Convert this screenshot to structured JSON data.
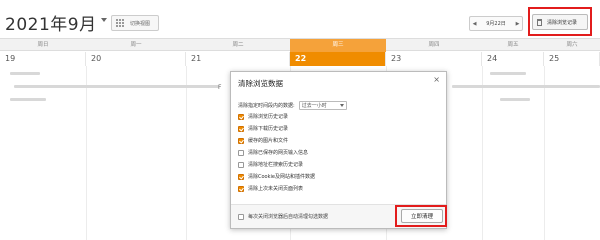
{
  "header": {
    "month_title": "2021年9月",
    "toggle_view_label": "切换视图",
    "date_nav_value": "9月22日",
    "clear_history_label": "清除浏览记录"
  },
  "calendar": {
    "weekdays": [
      "周日",
      "周一",
      "周二",
      "周三",
      "周四",
      "周五",
      "周六"
    ],
    "days": [
      "19",
      "20",
      "21",
      "22",
      "23",
      "24",
      "25"
    ],
    "today_index": 3,
    "event_fragment": "F",
    "accent_color": "#f08c00"
  },
  "dialog": {
    "title": "清除浏览数据",
    "range_label": "清除指定时间段内的数据:",
    "range_value": "过去一小时",
    "options": [
      {
        "label": "清除浏览历史记录",
        "checked": true
      },
      {
        "label": "清除下载历史记录",
        "checked": true
      },
      {
        "label": "缓存的图片和文件",
        "checked": true
      },
      {
        "label": "清除已保存的网页输入信息",
        "checked": false
      },
      {
        "label": "清除地址栏搜索历史记录",
        "checked": false
      },
      {
        "label": "清除Cookie及网站和插件数据",
        "checked": true
      },
      {
        "label": "清除上次未关闭页面列表",
        "checked": true
      }
    ],
    "auto_clear_label": "每次关闭浏览器后自动清理勾选数据",
    "auto_clear_checked": false,
    "clear_now_label": "立即清理",
    "highlight_color": "#e21c1c"
  }
}
